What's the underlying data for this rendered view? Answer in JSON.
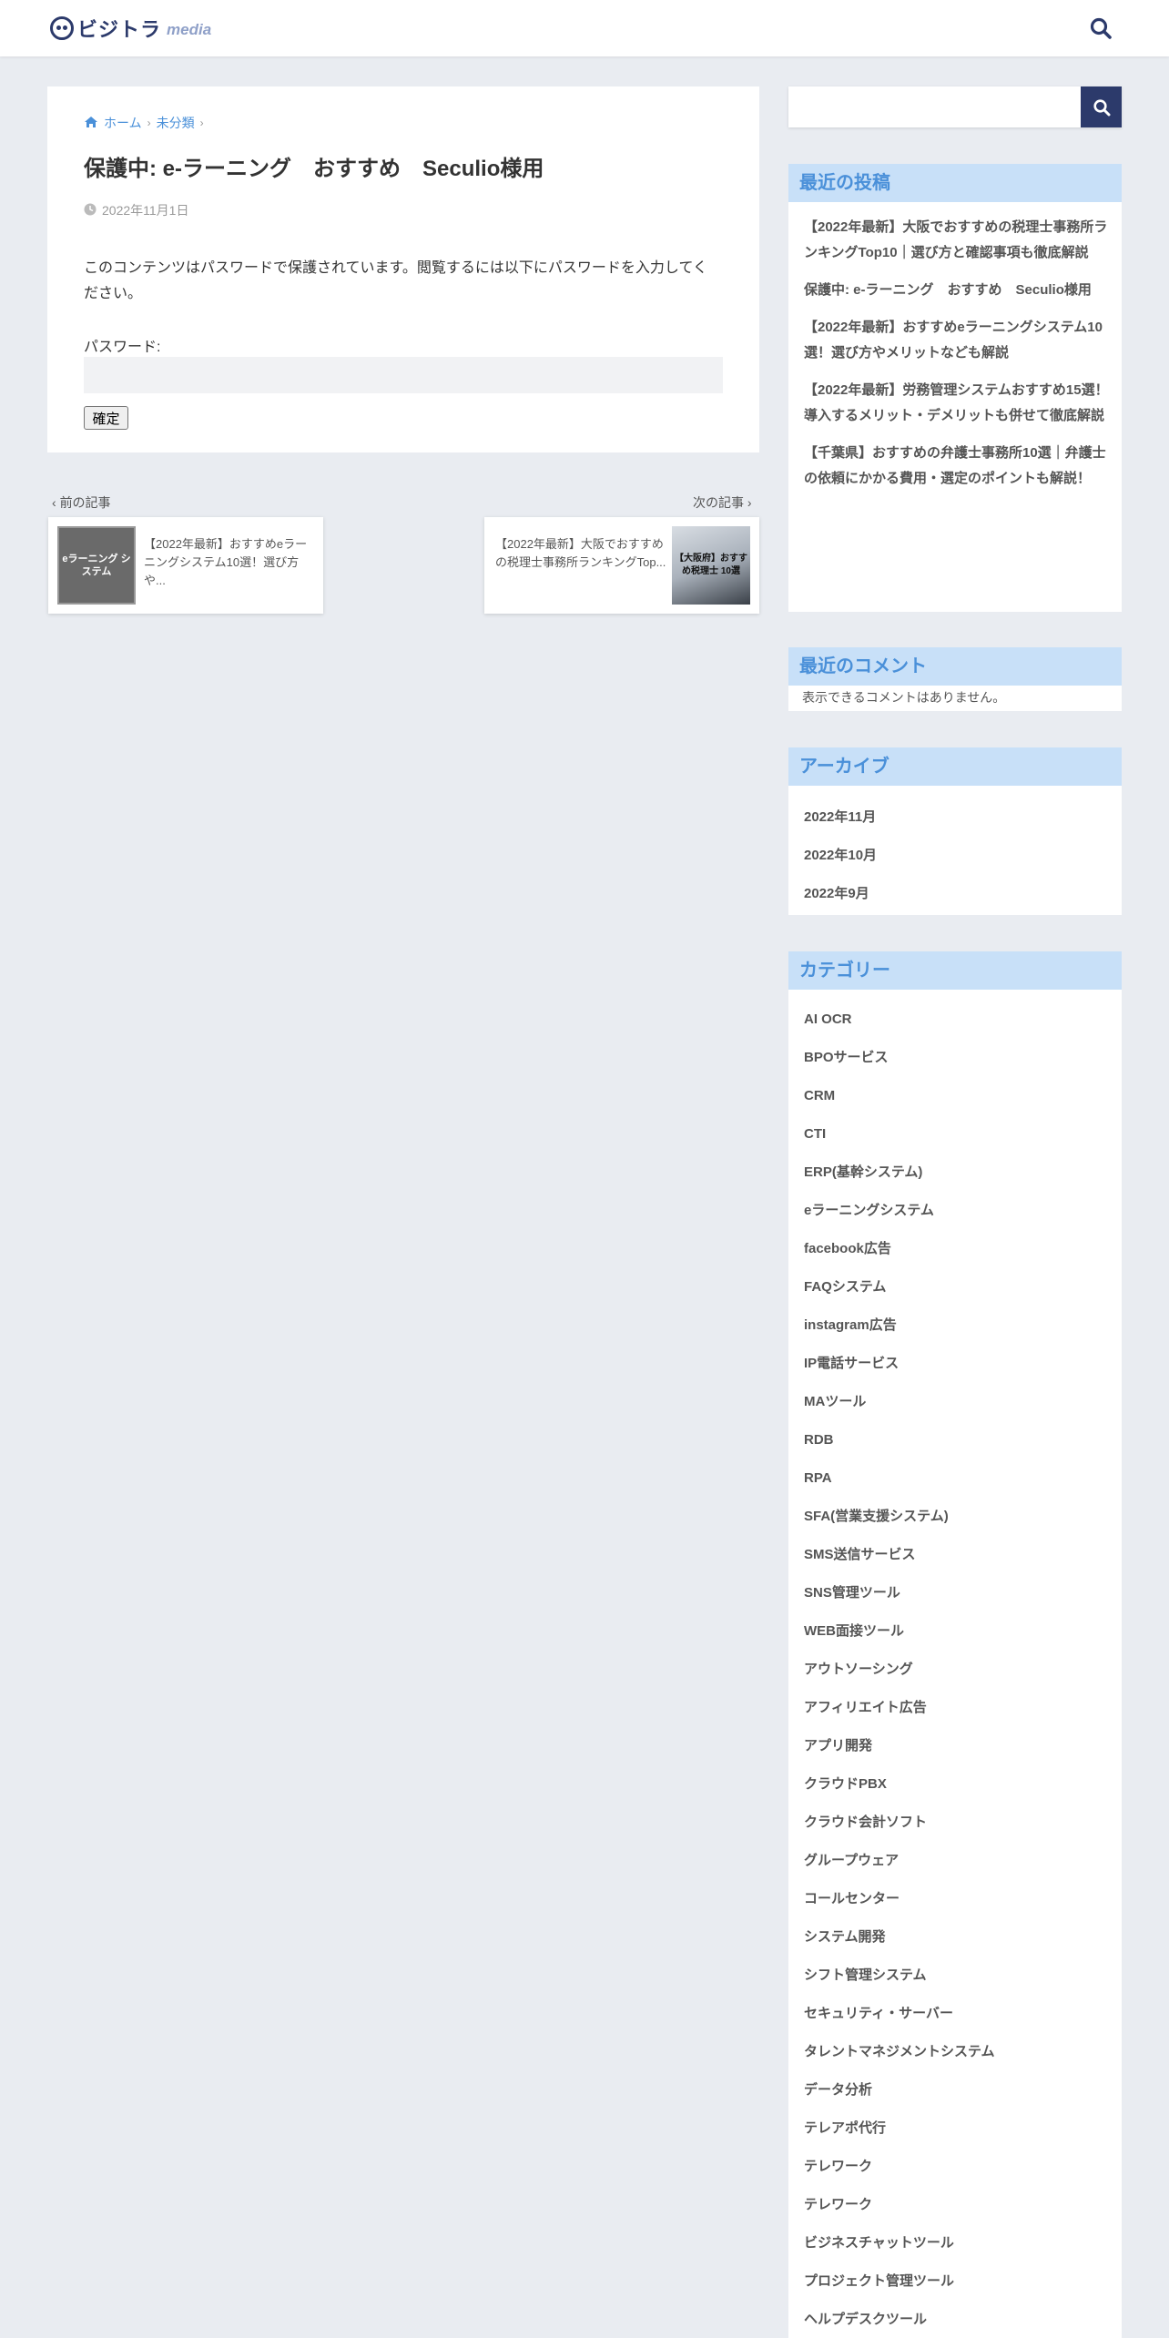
{
  "header": {
    "logo_text": "ビジトラ",
    "logo_sub": "media"
  },
  "breadcrumb": {
    "home": "ホーム",
    "category": "未分類"
  },
  "post": {
    "title": "保護中: e-ラーニング　おすすめ　Seculio様用",
    "date": "2022年11月1日",
    "body": "このコンテンツはパスワードで保護されています。閲覧するには以下にパスワードを入力してください。",
    "password_label": "パスワード:",
    "submit_label": "確定"
  },
  "nav": {
    "prev_label": "前の記事",
    "next_label": "次の記事",
    "prev_title": "【2022年最新】おすすめeラーニングシステム10選！選び方や...",
    "prev_thumb_text": "eラーニング システム",
    "next_title": "【2022年最新】大阪でおすすめの税理士事務所ランキングTop...",
    "next_thumb_text": "【大阪府】おすすめ税理士 10選"
  },
  "sidebar": {
    "recent_posts": {
      "title": "最近の投稿",
      "items": [
        "【2022年最新】大阪でおすすめの税理士事務所ランキングTop10｜選び方と確認事項も徹底解説",
        "保護中: e-ラーニング　おすすめ　Seculio様用",
        "【2022年最新】おすすめeラーニングシステム10選！選び方やメリットなども解説",
        "【2022年最新】労務管理システムおすすめ15選！導入するメリット・デメリットも併せて徹底解説",
        "【千葉県】おすすめの弁護士事務所10選｜弁護士の依頼にかかる費用・選定のポイントも解説！"
      ]
    },
    "recent_comments": {
      "title": "最近のコメント",
      "empty": "表示できるコメントはありません。"
    },
    "archive": {
      "title": "アーカイブ",
      "items": [
        "2022年11月",
        "2022年10月",
        "2022年9月"
      ]
    },
    "categories": {
      "title": "カテゴリー",
      "items": [
        "AI OCR",
        "BPOサービス",
        "CRM",
        "CTI",
        "ERP(基幹システム)",
        "eラーニングシステム",
        "facebook広告",
        "FAQシステム",
        "instagram広告",
        "IP電話サービス",
        "MAツール",
        "RDB",
        "RPA",
        "SFA(営業支援システム)",
        "SMS送信サービス",
        "SNS管理ツール",
        "WEB面接ツール",
        "アウトソーシング",
        "アフィリエイト広告",
        "アプリ開発",
        "クラウドPBX",
        "クラウド会計ソフト",
        "グループウェア",
        "コールセンター",
        "システム開発",
        "シフト管理システム",
        "セキュリティ・サーバー",
        "タレントマネジメントシステム",
        "データ分析",
        "テレアポ代行",
        "テレワーク",
        "テレワーク",
        "ビジネスチャットツール",
        "プロジェクト管理ツール",
        "ヘルプデスクツール"
      ]
    }
  },
  "colors": {
    "brand": "#2c3a6b",
    "link": "#4a90d9",
    "widget_title_bg": "#c8e0f8",
    "page_bg": "#e9ecf1"
  }
}
